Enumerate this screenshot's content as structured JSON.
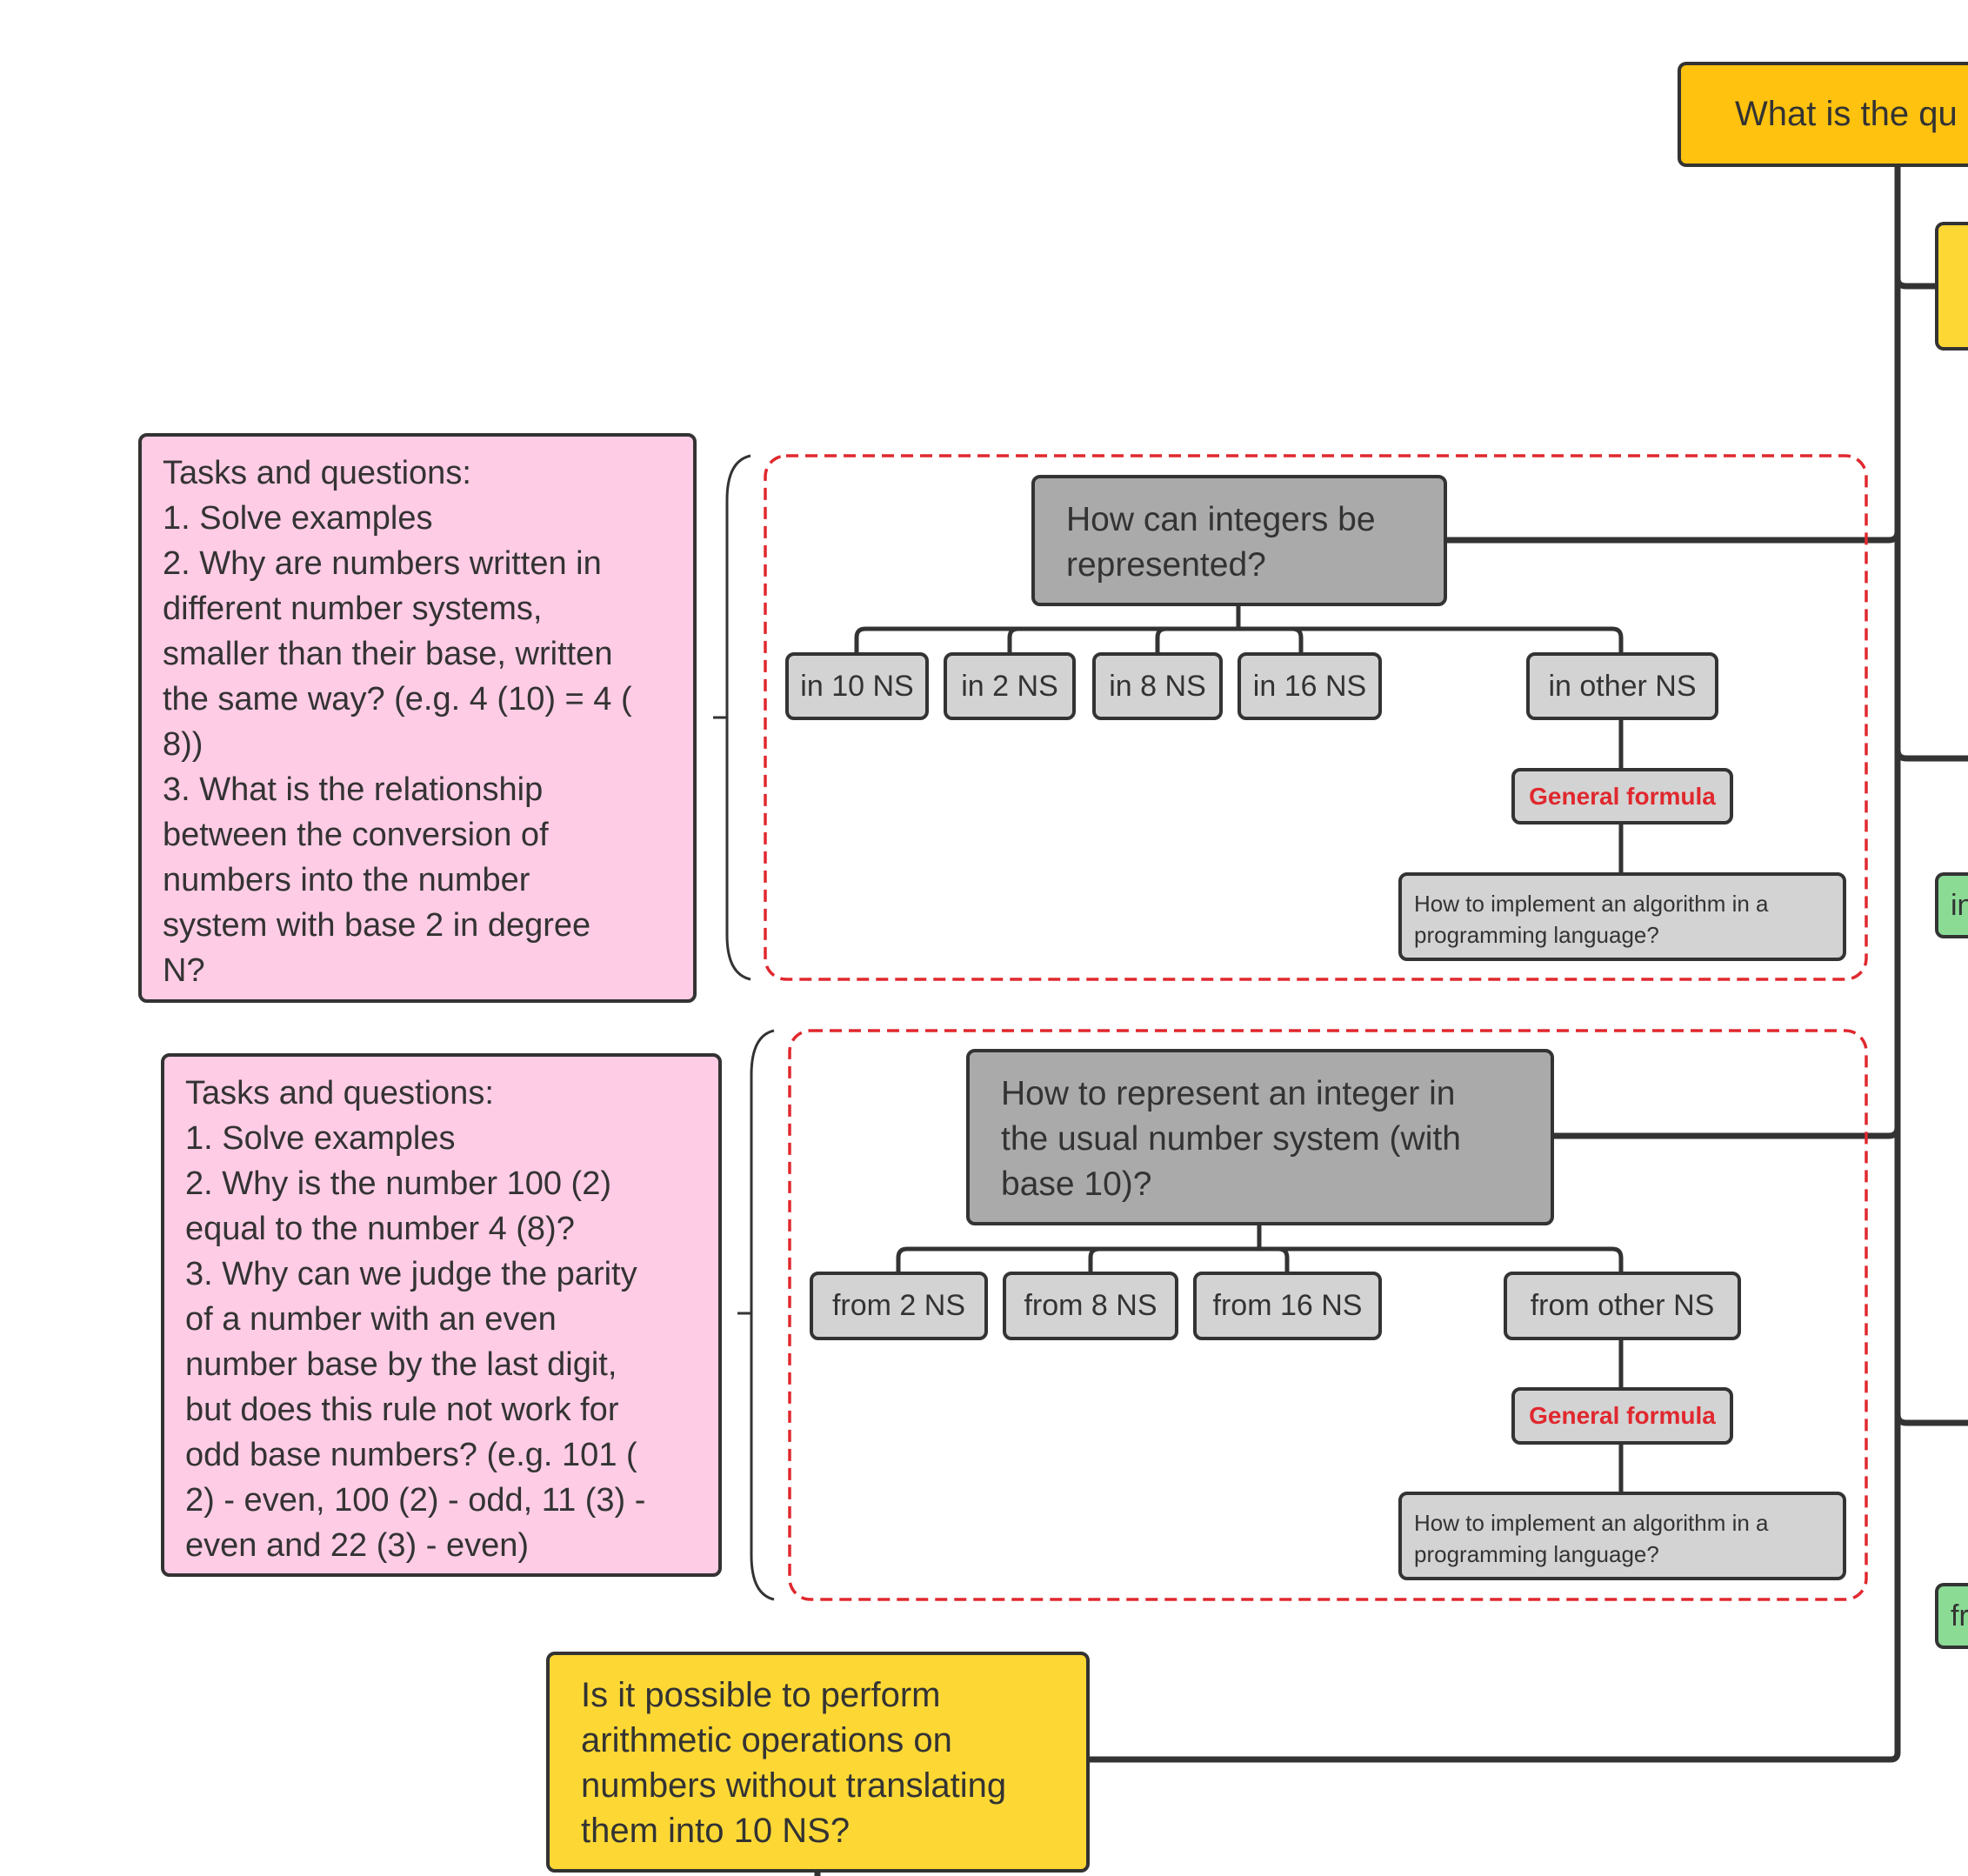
{
  "colors": {
    "root": "#FFC20E",
    "question": "#FDD835",
    "tasks": "#FFCCE5",
    "topic": "#AAAAAA",
    "leaf": "#D3D3D3",
    "green": "#8BDB95",
    "accent_red": "#E0282E",
    "stroke": "#333333"
  },
  "root": {
    "label": "What is the qu"
  },
  "side": {
    "green1": "in",
    "green2": "fr"
  },
  "group1": {
    "tasks": [
      "Tasks and questions:",
      "1. Solve examples",
      "2. Why are numbers written in",
      "different number systems,",
      "smaller than their base, written",
      "the same way? (e.g. 4 (10) = 4 (",
      "8))",
      "3. What is the relationship",
      "between the conversion of",
      "numbers into the number",
      "system with base 2 in degree",
      "N?"
    ],
    "topic": [
      "How can integers be",
      "represented?"
    ],
    "children": [
      "in 10 NS",
      "in 2 NS",
      "in 8 NS",
      "in 16 NS",
      "in other NS"
    ],
    "formula": "General formula",
    "implement": [
      "How to implement an algorithm in a",
      "programming language?"
    ]
  },
  "group2": {
    "tasks": [
      "Tasks and questions:",
      "1. Solve examples",
      "2. Why is the number 100 (2)",
      "equal to the number 4 (8)?",
      "3. Why can we judge the parity",
      "of a number with an even",
      "number base by the last digit,",
      "but does this rule not work for",
      "odd base numbers? (e.g. 101 (",
      "2) - even, 100 (2) - odd, 11 (3) -",
      "even and 22 (3) - even)"
    ],
    "topic": [
      "How to represent an integer in",
      "the usual number system (with",
      "base 10)?"
    ],
    "children": [
      "from 2 NS",
      "from 8 NS",
      "from 16 NS",
      "from other NS"
    ],
    "formula": "General formula",
    "implement": [
      "How to implement an algorithm in a",
      "programming language?"
    ]
  },
  "bottom_question": [
    "Is it possible to perform",
    "arithmetic operations on",
    "numbers without translating",
    "them into 10 NS?"
  ]
}
